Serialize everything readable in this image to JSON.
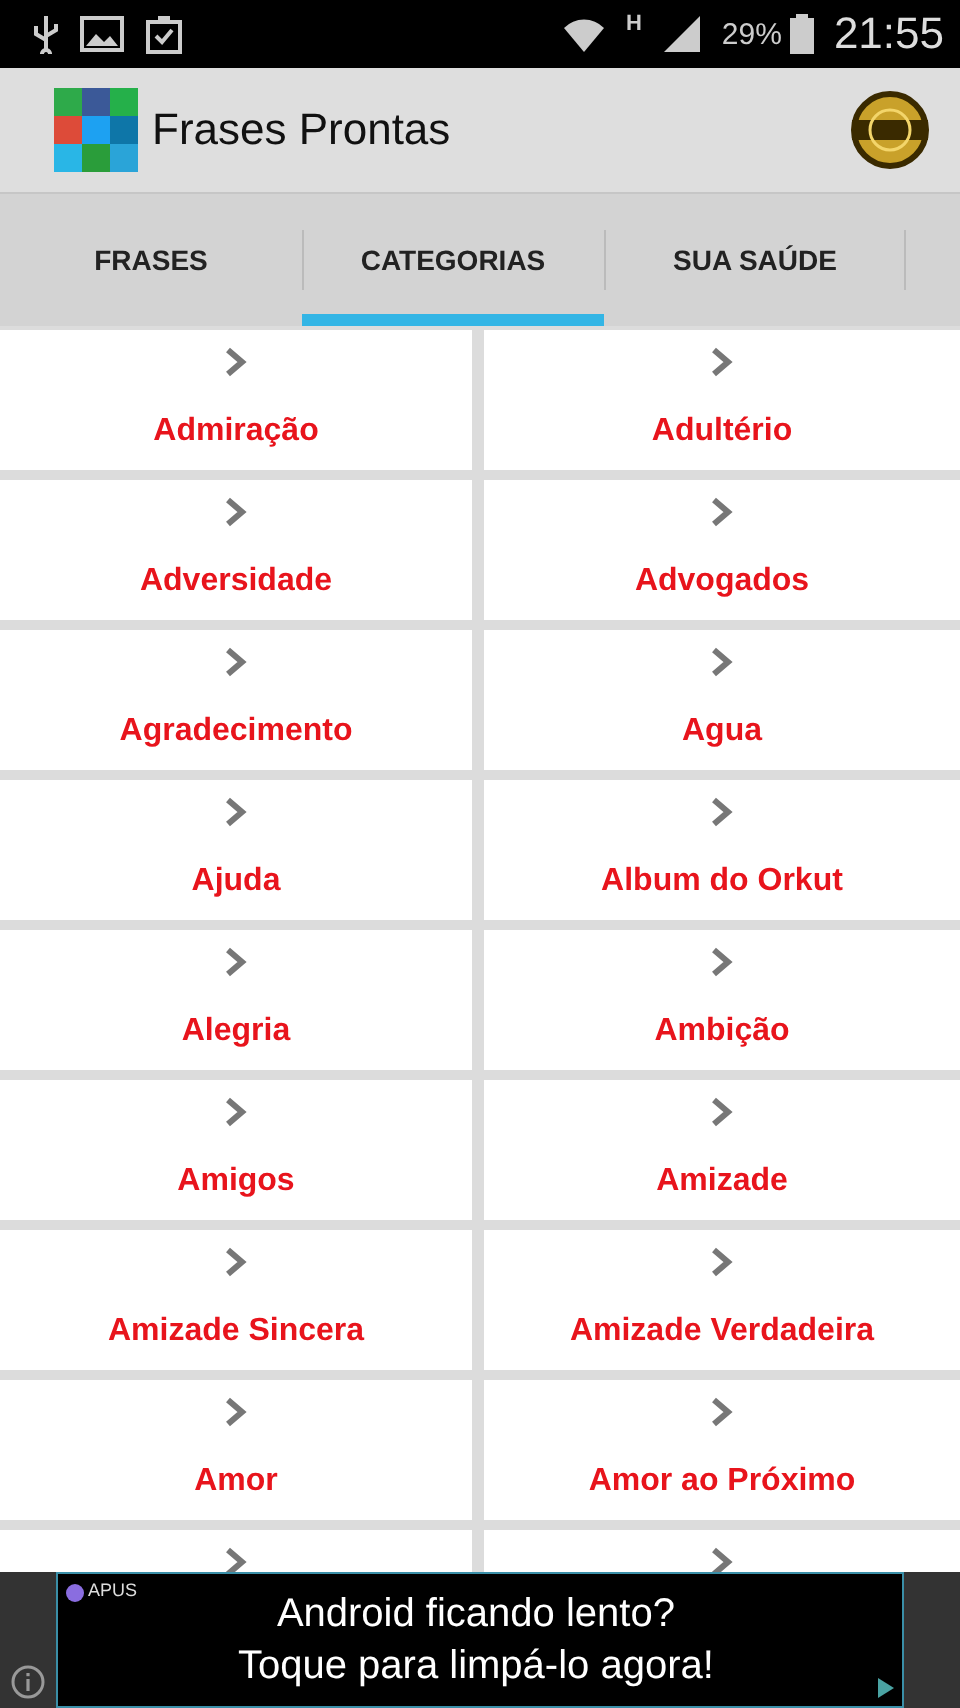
{
  "status_bar": {
    "network": "H",
    "battery": "29%",
    "time": "21:55"
  },
  "app_bar": {
    "title": "Frases Prontas"
  },
  "tabs": [
    {
      "label": "FRASES",
      "selected": false
    },
    {
      "label": "CATEGORIAS",
      "selected": true
    },
    {
      "label": "SUA SAÚDE",
      "selected": false
    }
  ],
  "categories": [
    {
      "kind": "item",
      "label": "Admiração"
    },
    {
      "kind": "item",
      "label": "Adultério"
    },
    {
      "kind": "item",
      "label": "Adversidade"
    },
    {
      "kind": "item",
      "label": "Advogados"
    },
    {
      "kind": "item",
      "label": "Agradecimento"
    },
    {
      "kind": "item",
      "label": "Agua"
    },
    {
      "kind": "item",
      "label": "Ajuda"
    },
    {
      "kind": "item",
      "label": "Album do Orkut"
    },
    {
      "kind": "item",
      "label": "Alegria"
    },
    {
      "kind": "item",
      "label": "Ambição"
    },
    {
      "kind": "item",
      "label": "Amigos"
    },
    {
      "kind": "item",
      "label": "Amizade"
    },
    {
      "kind": "item",
      "label": "Amizade Sincera"
    },
    {
      "kind": "item",
      "label": "Amizade Verdadeira"
    },
    {
      "kind": "item",
      "label": "Amor"
    },
    {
      "kind": "item",
      "label": "Amor ao Próximo"
    },
    {
      "kind": "cut"
    },
    {
      "kind": "cut"
    }
  ],
  "ad": {
    "brand": "APUS",
    "lines": [
      "Android ficando lento?",
      "Toque para limpá-lo agora!"
    ]
  }
}
